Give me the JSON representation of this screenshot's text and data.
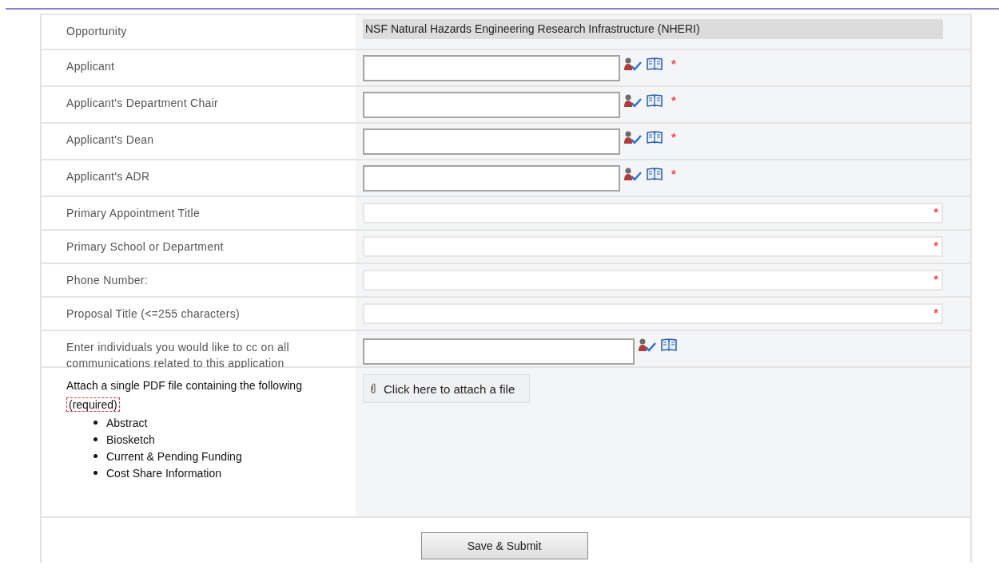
{
  "required_mark": "*",
  "fields": [
    {
      "kind": "readonly",
      "label": "Opportunity",
      "value": "NSF Natural Hazards Engineering Research Infrastructure (NHERI)",
      "required": false
    },
    {
      "kind": "people",
      "label": "Applicant",
      "required": true
    },
    {
      "kind": "people",
      "label": "Applicant's Department Chair",
      "required": true
    },
    {
      "kind": "people",
      "label": "Applicant's Dean",
      "required": true
    },
    {
      "kind": "people",
      "label": "Applicant's ADR",
      "required": true
    },
    {
      "kind": "text",
      "label": "Primary Appointment Title",
      "required": true
    },
    {
      "kind": "text",
      "label": "Primary School or Department",
      "required": true
    },
    {
      "kind": "text",
      "label": "Phone Number:",
      "required": true
    },
    {
      "kind": "text",
      "label": "Proposal Title (<=255 characters)",
      "required": true
    },
    {
      "kind": "people",
      "label": "Enter individuals you would like to cc on all communications related to this application",
      "required": false
    },
    {
      "kind": "attach",
      "label": "Attach a single PDF file containing the following",
      "note": "(required)",
      "items": [
        "Abstract",
        "Biosketch",
        "Current & Pending Funding",
        "Cost Share Information"
      ],
      "button": "Click here to attach a file",
      "required": false
    }
  ],
  "submit": "Save & Submit"
}
